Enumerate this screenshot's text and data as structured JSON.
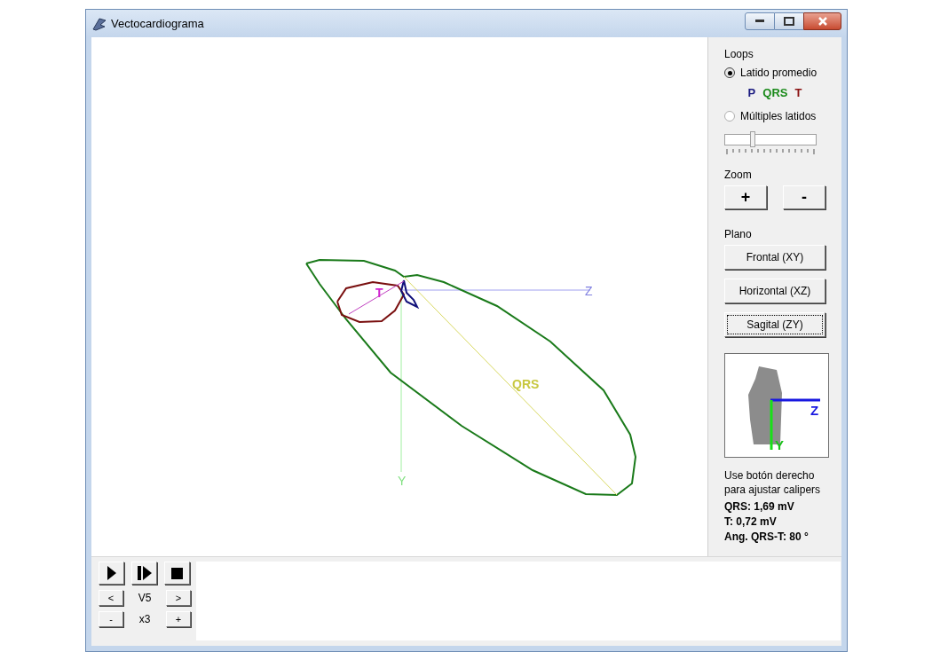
{
  "window": {
    "title": "Vectocardiograma"
  },
  "plot": {
    "z_label": "Z",
    "y_label": "Y",
    "qrs_label": "QRS",
    "t_label": "T"
  },
  "panel": {
    "loops_label": "Loops",
    "loop_options": [
      {
        "label": "Latido promedio",
        "selected": true
      },
      {
        "label": "Múltiples latidos",
        "selected": false
      }
    ],
    "legend": [
      {
        "text": "P",
        "color": "#1a1a80"
      },
      {
        "text": "QRS",
        "color": "#1a8a1a"
      },
      {
        "text": "T",
        "color": "#8a1010"
      }
    ],
    "slider": {
      "level": 0.3
    },
    "zoom_label": "Zoom",
    "zoom_buttons": [
      "+",
      "-"
    ],
    "plane_label": "Plano",
    "plane_buttons": [
      {
        "label": "Frontal (XY)",
        "selected": false
      },
      {
        "label": "Horizontal (XZ)",
        "selected": false
      },
      {
        "label": "Sagital (ZY)",
        "selected": true
      }
    ],
    "torso": {
      "z_label": "Z",
      "y_label": "Y"
    },
    "hint": "Use botón derecho para ajustar calipers",
    "measurements": [
      "QRS: 1,69 mV",
      "T: 0,72 mV",
      "Ang. QRS-T: 80 °"
    ]
  },
  "controls": {
    "lead_prev": "<",
    "lead": "V5",
    "lead_next": ">",
    "gain_down": "-",
    "gain": "x3",
    "gain_up": "+"
  }
}
